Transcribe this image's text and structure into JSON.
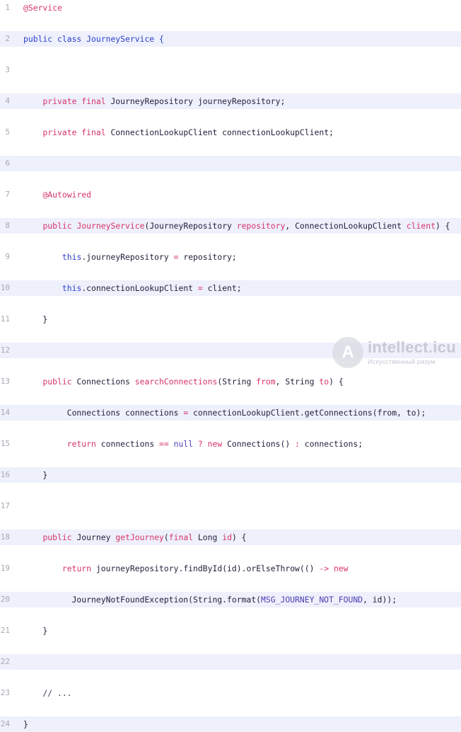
{
  "code_lines": [
    {
      "n": "1",
      "tokens": [
        {
          "t": "@Service",
          "c": "ann"
        }
      ]
    },
    {
      "n": "2",
      "tokens": [
        {
          "t": "public class JourneyService {",
          "c": "kw2"
        }
      ]
    },
    {
      "n": "3",
      "tokens": []
    },
    {
      "n": "4",
      "tokens": [
        {
          "t": "    "
        },
        {
          "t": "private final",
          "c": "kw"
        },
        {
          "t": " JourneyRepository journeyRepository;"
        }
      ]
    },
    {
      "n": "5",
      "tokens": [
        {
          "t": "    "
        },
        {
          "t": "private final",
          "c": "kw"
        },
        {
          "t": " ConnectionLookupClient connectionLookupClient;"
        }
      ]
    },
    {
      "n": "6",
      "tokens": []
    },
    {
      "n": "7",
      "tokens": [
        {
          "t": "    "
        },
        {
          "t": "@Autowired",
          "c": "ann"
        }
      ]
    },
    {
      "n": "8",
      "tokens": [
        {
          "t": "    "
        },
        {
          "t": "public",
          "c": "kw"
        },
        {
          "t": " "
        },
        {
          "t": "JourneyService",
          "c": "fn"
        },
        {
          "t": "(JourneyRepository "
        },
        {
          "t": "repository",
          "c": "param"
        },
        {
          "t": ", ConnectionLookupClient "
        },
        {
          "t": "client",
          "c": "param"
        },
        {
          "t": ") {"
        }
      ]
    },
    {
      "n": "9",
      "tokens": [
        {
          "t": "        "
        },
        {
          "t": "this",
          "c": "kw2"
        },
        {
          "t": ".journeyRepository "
        },
        {
          "t": "=",
          "c": "kw"
        },
        {
          "t": " repository;"
        }
      ]
    },
    {
      "n": "10",
      "tokens": [
        {
          "t": "        "
        },
        {
          "t": "this",
          "c": "kw2"
        },
        {
          "t": ".connectionLookupClient "
        },
        {
          "t": "=",
          "c": "kw"
        },
        {
          "t": " client;"
        }
      ]
    },
    {
      "n": "11",
      "tokens": [
        {
          "t": "    }"
        }
      ]
    },
    {
      "n": "12",
      "tokens": []
    },
    {
      "n": "13",
      "tokens": [
        {
          "t": "    "
        },
        {
          "t": "public",
          "c": "kw"
        },
        {
          "t": " Connections "
        },
        {
          "t": "searchConnections",
          "c": "fn"
        },
        {
          "t": "(String "
        },
        {
          "t": "from",
          "c": "param"
        },
        {
          "t": ", String "
        },
        {
          "t": "to",
          "c": "param"
        },
        {
          "t": ") {"
        }
      ]
    },
    {
      "n": "14",
      "tokens": [
        {
          "t": "         Connections connections "
        },
        {
          "t": "=",
          "c": "kw"
        },
        {
          "t": " connectionLookupClient.getConnections(from, to);"
        }
      ]
    },
    {
      "n": "15",
      "tokens": [
        {
          "t": "         "
        },
        {
          "t": "return",
          "c": "kw"
        },
        {
          "t": " connections "
        },
        {
          "t": "==",
          "c": "kw"
        },
        {
          "t": " "
        },
        {
          "t": "null",
          "c": "lit"
        },
        {
          "t": " "
        },
        {
          "t": "?",
          "c": "kw"
        },
        {
          "t": " "
        },
        {
          "t": "new",
          "c": "kw"
        },
        {
          "t": " Connections() "
        },
        {
          "t": ":",
          "c": "kw"
        },
        {
          "t": " connections;"
        }
      ]
    },
    {
      "n": "16",
      "tokens": [
        {
          "t": "    }"
        }
      ]
    },
    {
      "n": "17",
      "tokens": []
    },
    {
      "n": "18",
      "tokens": [
        {
          "t": "    "
        },
        {
          "t": "public",
          "c": "kw"
        },
        {
          "t": " Journey "
        },
        {
          "t": "getJourney",
          "c": "fn"
        },
        {
          "t": "("
        },
        {
          "t": "final",
          "c": "kw"
        },
        {
          "t": " Long "
        },
        {
          "t": "id",
          "c": "param"
        },
        {
          "t": ") {"
        }
      ]
    },
    {
      "n": "19",
      "tokens": [
        {
          "t": "        "
        },
        {
          "t": "return",
          "c": "kw"
        },
        {
          "t": " journeyRepository.findById(id).orElseThrow(() "
        },
        {
          "t": "->",
          "c": "kw"
        },
        {
          "t": " "
        },
        {
          "t": "new",
          "c": "kw"
        }
      ]
    },
    {
      "n": "20",
      "tokens": [
        {
          "t": "          JourneyNotFoundException(String.format("
        },
        {
          "t": "MSG_JOURNEY_NOT_FOUND",
          "c": "const"
        },
        {
          "t": ", id));"
        }
      ]
    },
    {
      "n": "21",
      "tokens": [
        {
          "t": "    }"
        }
      ]
    },
    {
      "n": "22",
      "tokens": []
    },
    {
      "n": "23",
      "tokens": [
        {
          "t": "    // ...",
          "c": "cmt"
        }
      ]
    },
    {
      "n": "24",
      "tokens": [
        {
          "t": "}"
        }
      ]
    }
  ],
  "watermark": {
    "letter": "A",
    "name": "intellect.icu",
    "tagline": "Искусственный разум"
  }
}
